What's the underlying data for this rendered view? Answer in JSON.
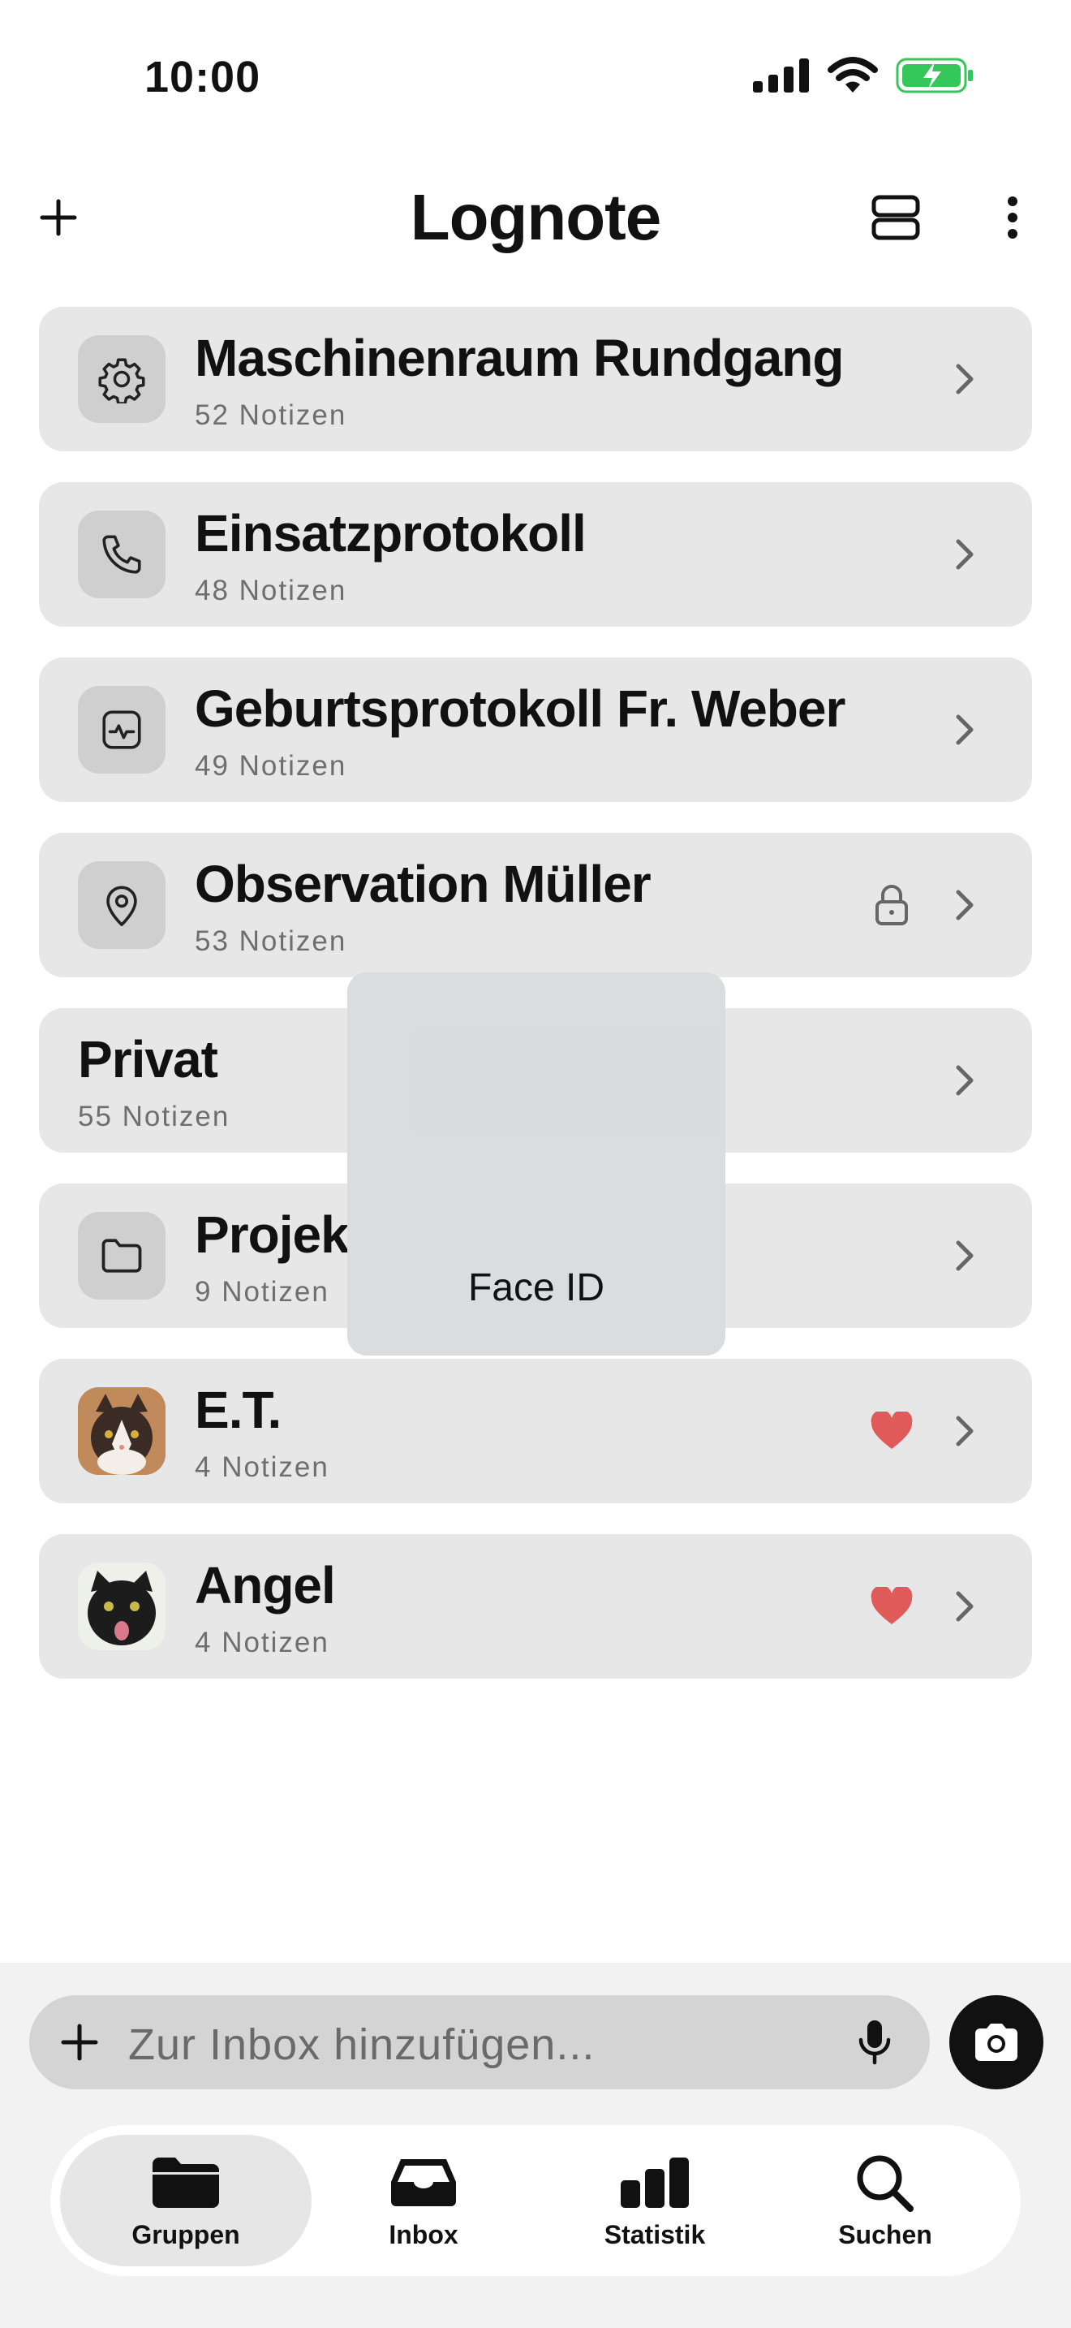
{
  "status_bar": {
    "time": "10:00"
  },
  "header": {
    "title": "Lognote"
  },
  "groups": [
    {
      "title": "Maschinenraum Rundgang",
      "count": "52 Notizen",
      "icon": "gear-icon"
    },
    {
      "title": "Einsatzprotokoll",
      "count": "48 Notizen",
      "icon": "phone-icon"
    },
    {
      "title": "Geburtsprotokoll Fr. Weber",
      "count": "49 Notizen",
      "icon": "heart-monitor-icon"
    },
    {
      "title": "Observation Müller",
      "count": "53 Notizen",
      "icon": "location-pin-icon",
      "locked": true
    },
    {
      "title": "Privat",
      "count": "55 Notizen"
    },
    {
      "title": "Projek",
      "count": "9 Notizen",
      "icon": "folder-icon"
    },
    {
      "title": "E.T.",
      "count": "4 Notizen",
      "icon": "cat-photo",
      "favorite": true
    },
    {
      "title": "Angel",
      "count": "4 Notizen",
      "icon": "cat-photo",
      "favorite": true
    }
  ],
  "faceid": {
    "label": "Face ID"
  },
  "inbox": {
    "placeholder": "Zur Inbox hinzufügen..."
  },
  "tabs": [
    {
      "label": "Gruppen",
      "icon": "folder-icon",
      "active": true
    },
    {
      "label": "Inbox",
      "icon": "inbox-tray-icon"
    },
    {
      "label": "Statistik",
      "icon": "bar-chart-icon"
    },
    {
      "label": "Suchen",
      "icon": "search-icon"
    }
  ],
  "colors": {
    "favorite": "#e05a5a",
    "battery": "#34c759",
    "row_bg": "#e7e7e7"
  }
}
